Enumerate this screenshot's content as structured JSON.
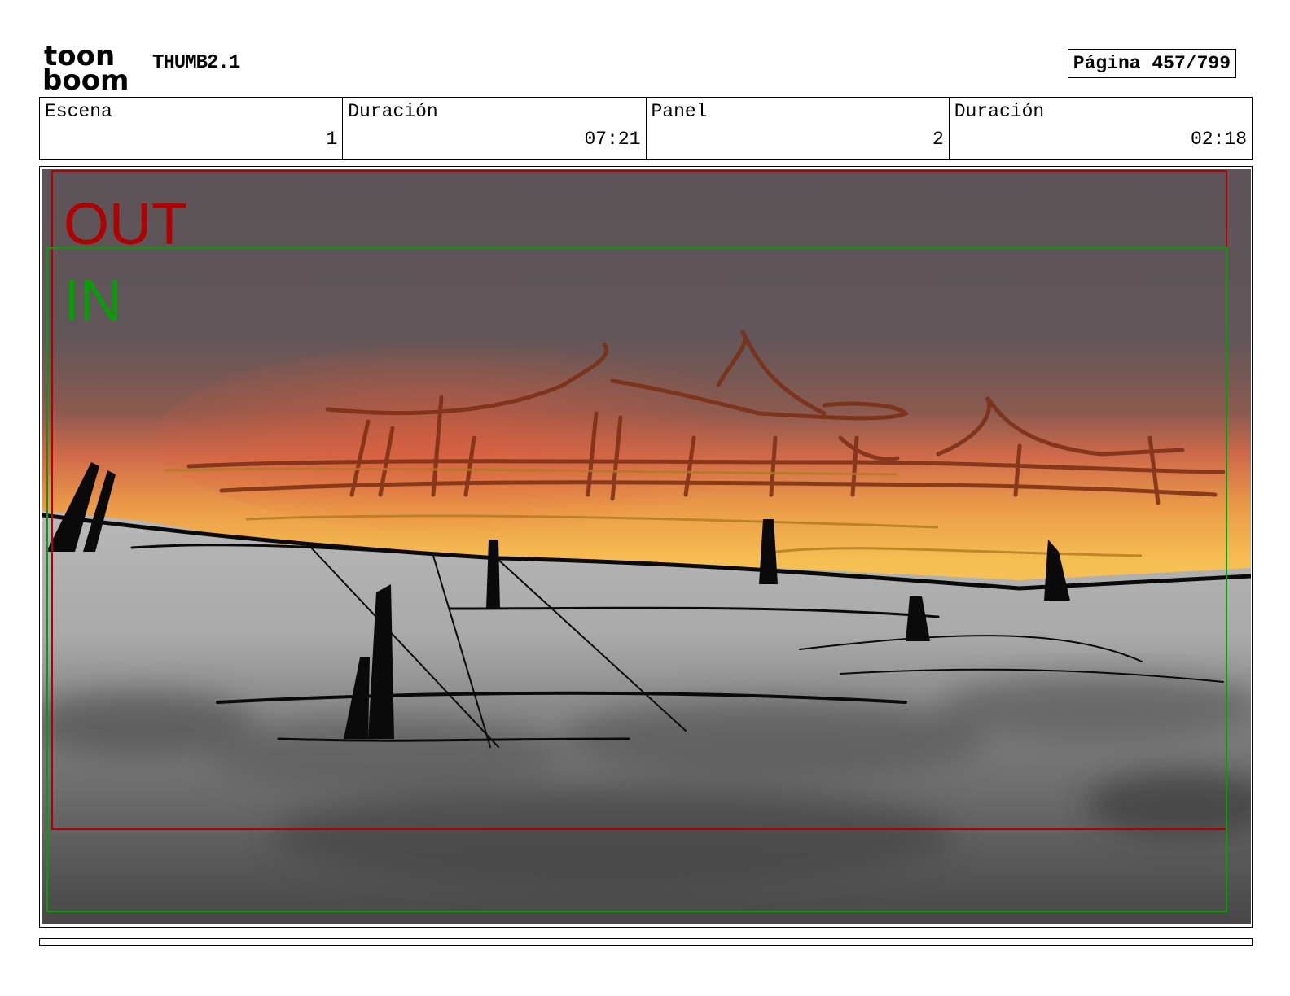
{
  "header": {
    "logo_text_top": "toon",
    "logo_text_bottom": "boom",
    "title": "THUMB2.1",
    "page_label": "Página 457/799"
  },
  "info": [
    {
      "label": "Escena",
      "value": "1"
    },
    {
      "label": "Duración",
      "value": "07:21"
    },
    {
      "label": "Panel",
      "value": "2"
    },
    {
      "label": "Duración",
      "value": "02:18"
    }
  ],
  "panel": {
    "out_label": "OUT",
    "in_label": "IN",
    "out_color": "#b00000",
    "in_color": "#0a9a0a"
  }
}
